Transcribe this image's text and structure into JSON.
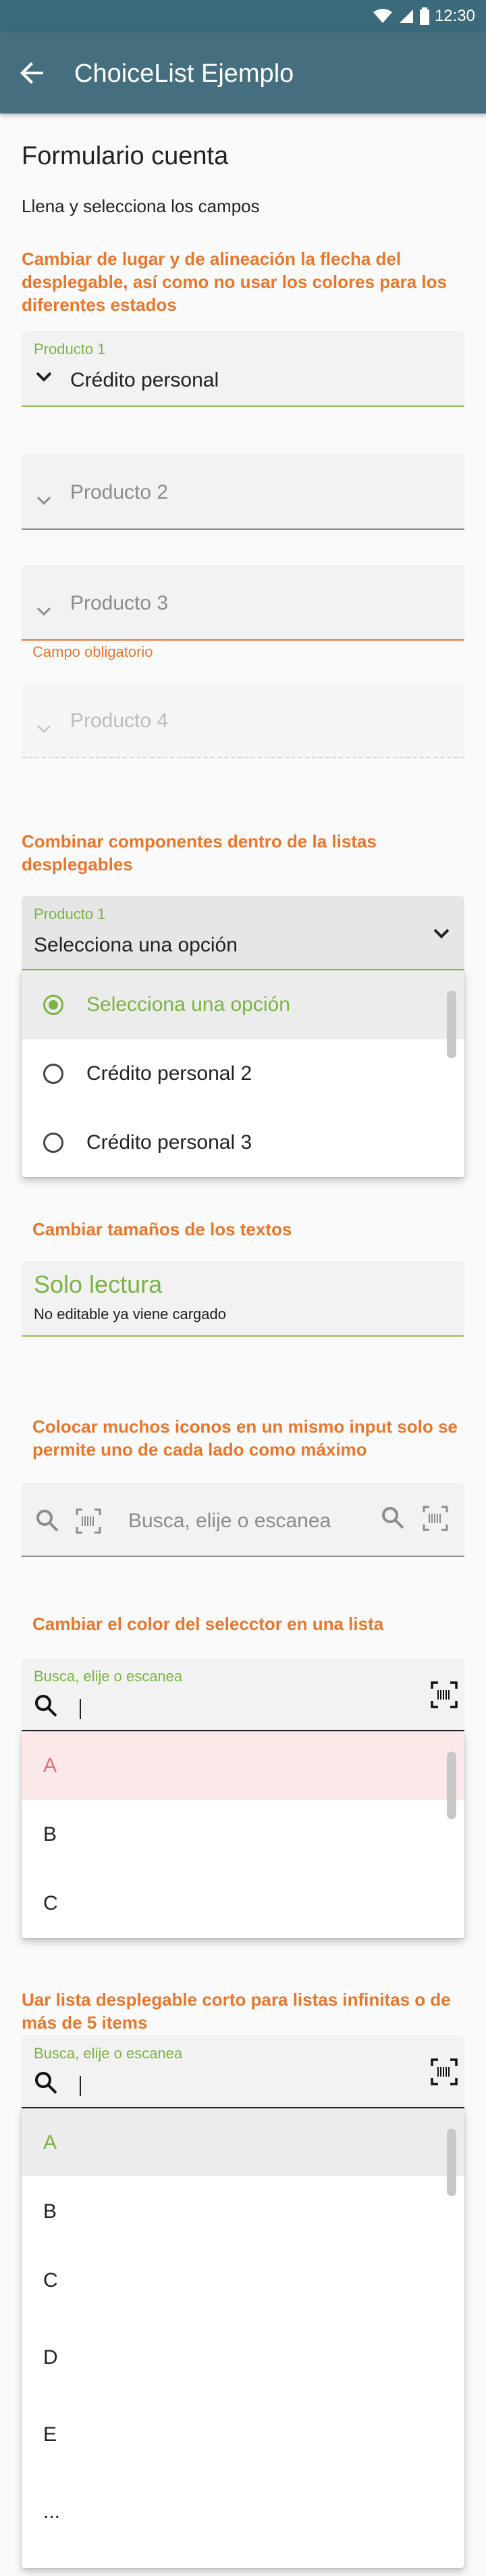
{
  "statusbar": {
    "time": "12:30"
  },
  "appbar": {
    "title": "ChoiceList Ejemplo"
  },
  "page": {
    "title": "Formulario cuenta",
    "subtitle": "Llena y selecciona los campos"
  },
  "section1": {
    "heading": "Cambiar de lugar y de alineación la flecha del desplegable, así como no usar los colores para los diferentes estados",
    "field1": {
      "label": "Producto 1",
      "value": "Crédito personal"
    },
    "field2": {
      "placeholder": "Producto 2"
    },
    "field3": {
      "placeholder": "Producto 3",
      "helper": "Campo obligatorio"
    },
    "field4": {
      "placeholder": "Producto 4"
    }
  },
  "section2": {
    "heading": "Combinar componentes dentro de la listas desplegables",
    "field": {
      "label": "Producto 1",
      "value": "Selecciona una opción"
    },
    "options": [
      "Selecciona una opción",
      "Crédito personal 2",
      "Crédito personal 3"
    ]
  },
  "section3": {
    "heading": "Cambiar tamaños de los textos",
    "value": "Solo lectura",
    "note": "No editable ya viene cargado"
  },
  "section4": {
    "heading": "Colocar muchos iconos en un mismo input solo se permite uno de cada lado como máximo",
    "placeholder": "Busca, elije o escanea"
  },
  "section5": {
    "heading": "Cambiar el color del selecctor en una lista",
    "label": "Busca, elije o escanea",
    "options": [
      "A",
      "B",
      "C"
    ]
  },
  "section6": {
    "heading": "Uar lista desplegable corto para listas infinitas o de más de 5 items",
    "label": "Busca, elije o escanea",
    "options": [
      "A",
      "B",
      "C",
      "D",
      "E",
      "..."
    ]
  },
  "colors": {
    "accent_green": "#7cb342",
    "accent_orange": "#e8772c",
    "appbar": "#456f7f"
  }
}
